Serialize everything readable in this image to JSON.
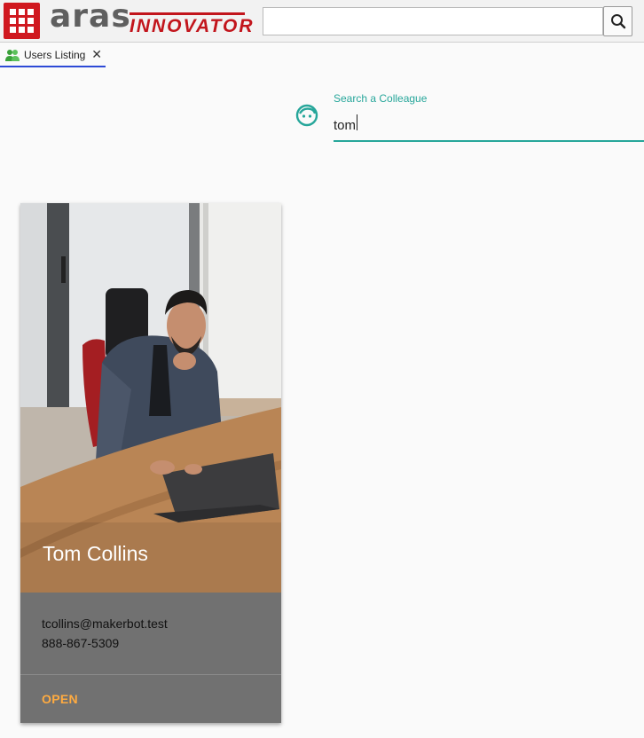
{
  "header": {
    "logo_primary": "aras",
    "logo_secondary": "INNOVATOR",
    "search_value": "",
    "brand_color": "#d0181f"
  },
  "tabs": [
    {
      "label": "Users Listing",
      "icon": "users-icon",
      "active": true
    }
  ],
  "colleague_search": {
    "label": "Search a Colleague",
    "value": "tom",
    "accent_color": "#26a69a",
    "icon": "face-icon"
  },
  "results": [
    {
      "name": "Tom Collins",
      "email": "tcollins@makerbot.test",
      "phone": "888-867-5309",
      "action_label": "OPEN",
      "action_color": "#ffab40"
    }
  ]
}
